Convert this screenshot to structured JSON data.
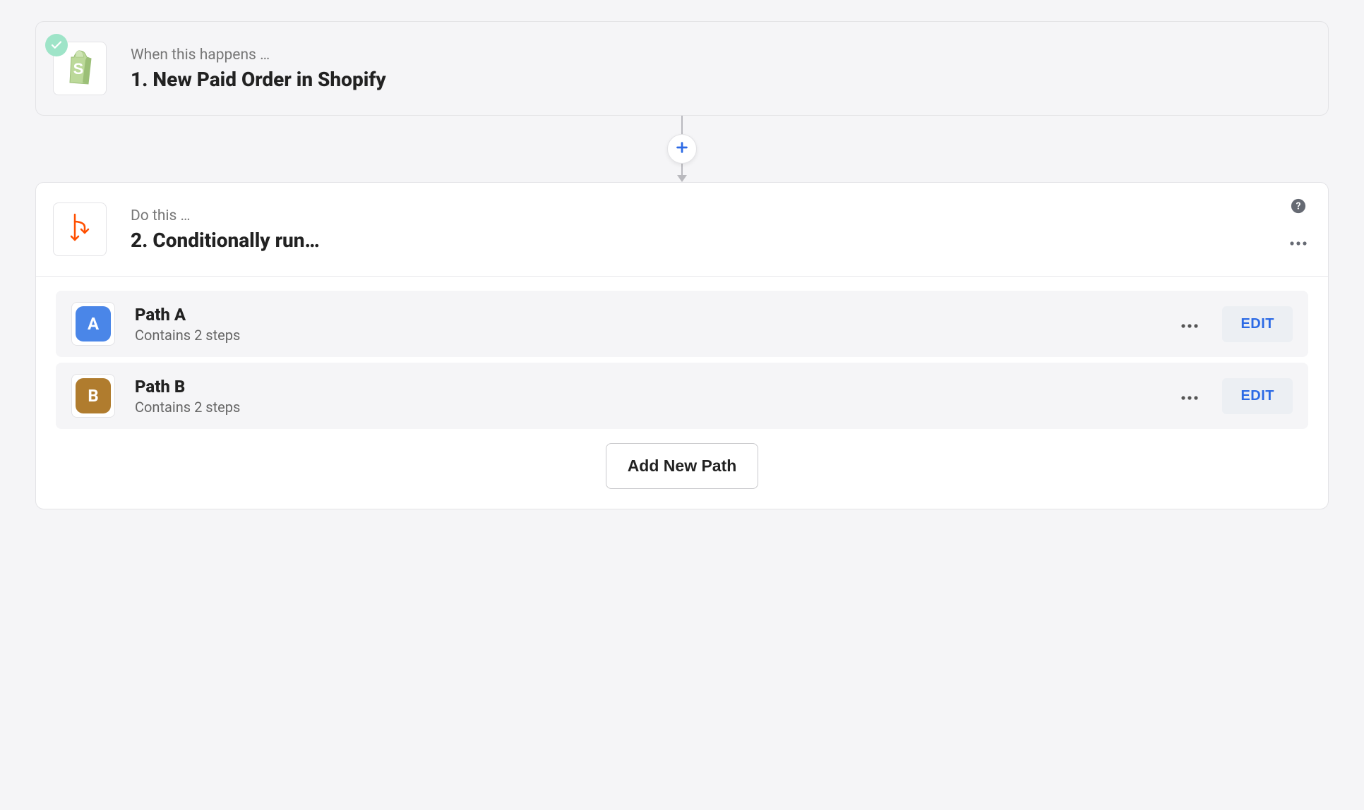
{
  "trigger": {
    "eyebrow": "When this happens …",
    "title": "1. New Paid Order in Shopify",
    "app_icon": "shopify-bag-icon"
  },
  "action": {
    "eyebrow": "Do this …",
    "title": "2. Conditionally run…",
    "app_icon": "paths-branch-icon"
  },
  "paths": [
    {
      "letter": "A",
      "name": "Path A",
      "sub": "Contains 2 steps",
      "color": "#4A86E8",
      "edit_label": "EDIT"
    },
    {
      "letter": "B",
      "name": "Path B",
      "sub": "Contains 2 steps",
      "color": "#B07C2E",
      "edit_label": "EDIT"
    }
  ],
  "add_path_label": "Add New Path"
}
